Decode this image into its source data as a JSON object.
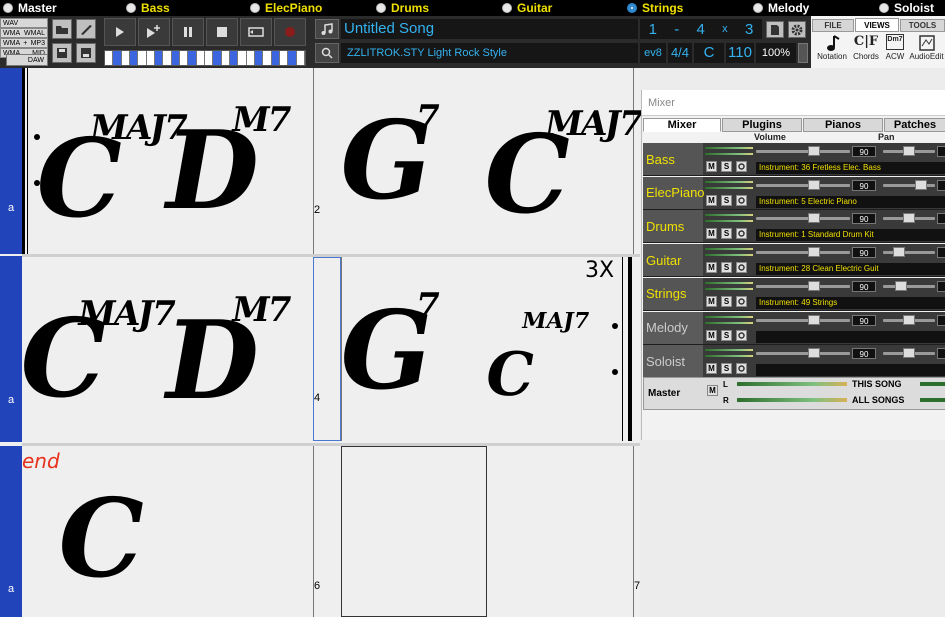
{
  "radio_bar": {
    "items": [
      {
        "label": "Master",
        "selected": false,
        "white": true
      },
      {
        "label": "Bass",
        "selected": false
      },
      {
        "label": "ElecPiano",
        "selected": false
      },
      {
        "label": "Drums",
        "selected": false
      },
      {
        "label": "Guitar",
        "selected": false
      },
      {
        "label": "Strings",
        "selected": true
      },
      {
        "label": "Melody",
        "selected": false,
        "white": true
      },
      {
        "label": "Soloist",
        "selected": false,
        "white": true
      }
    ]
  },
  "toolbar": {
    "file_buttons": [
      {
        "left": "WAV",
        "right": ""
      },
      {
        "left": "WMA",
        "right": "WMAL"
      },
      {
        "left": "WMA",
        "right": "MP3"
      },
      {
        "left": "WMA",
        "right": "MID"
      }
    ],
    "plus_sign": "+",
    "daw_label": "DAW",
    "song_title": "Untitled Song",
    "style_name": "ZZLITROK.STY Light Rock Style",
    "counter": {
      "a": "1",
      "sep": "-",
      "b": "4",
      "x": "x",
      "c": "3"
    },
    "ev_label": "ev8",
    "time_sig": "4/4",
    "key": "C",
    "tempo": "110",
    "volume": "100%",
    "tabs": [
      "FILE",
      "VIEWS",
      "TOOLS"
    ],
    "active_tab": "VIEWS",
    "view_icons": [
      "Notation",
      "Chords",
      "ACW",
      "AudioEdit"
    ],
    "chords_icon_text": "C|F",
    "acw_icon_text": "Dm7"
  },
  "sheet": {
    "rows": [
      {
        "tab_label": "a",
        "bar_num_2": "2",
        "chords": [
          "C",
          "D",
          "G",
          "C"
        ],
        "suffixes": [
          "MAJ7",
          "M7",
          "7",
          "MAJ7"
        ]
      },
      {
        "tab_label": "a",
        "bar_num_2": "4",
        "repeat_label": "3X",
        "chords": [
          "C",
          "D",
          "G",
          "C"
        ],
        "suffixes": [
          "MAJ7",
          "M7",
          "7",
          "MAJ7"
        ]
      },
      {
        "tab_label": "a",
        "end_label": "end",
        "bar_num_2": "6",
        "bar_num_3": "7",
        "chords": [
          "C"
        ]
      }
    ]
  },
  "mixer": {
    "title": "Mixer",
    "tabs": [
      "Mixer",
      "Plugins",
      "Pianos",
      "Patches"
    ],
    "active_tab": "Mixer",
    "col_volume": "Volume",
    "col_pan": "Pan",
    "tracks": [
      {
        "name": "Bass",
        "volume": "90",
        "instrument": "Instrument: 36 Fretless Elec. Bass",
        "active": true,
        "pan_pos": 0.5
      },
      {
        "name": "ElecPiano",
        "volume": "90",
        "instrument": "Instrument: 5 Electric Piano",
        "active": true,
        "pan_pos": 0.8
      },
      {
        "name": "Drums",
        "volume": "90",
        "instrument": "Instrument: 1 Standard Drum Kit",
        "active": true,
        "pan_pos": 0.5
      },
      {
        "name": "Guitar",
        "volume": "90",
        "instrument": "Instrument: 28 Clean Electric Guit",
        "active": true,
        "pan_pos": 0.25
      },
      {
        "name": "Strings",
        "volume": "90",
        "instrument": "Instrument: 49 Strings",
        "active": true,
        "pan_pos": 0.3
      },
      {
        "name": "Melody",
        "volume": "90",
        "instrument": "",
        "active": false,
        "pan_pos": 0.5
      },
      {
        "name": "Soloist",
        "volume": "90",
        "instrument": "",
        "active": false,
        "pan_pos": 0.5
      }
    ],
    "mute_label": "M",
    "solo_label": "S",
    "master": {
      "label": "Master",
      "mute": "M",
      "left": "L",
      "right": "R",
      "this_song": "THIS SONG",
      "all_songs": "ALL SONGS"
    }
  },
  "colors": {
    "accent_yellow": "#f0e000",
    "lcd_blue": "#34b2f0",
    "sheet_tab_blue": "#2244bb",
    "end_red": "#e8301c"
  }
}
